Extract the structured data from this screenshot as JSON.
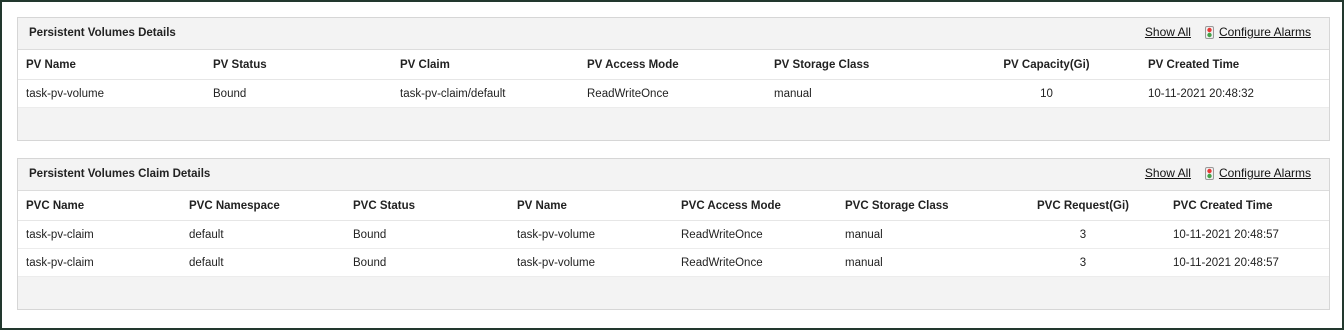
{
  "pv_panel": {
    "title": "Persistent Volumes Details",
    "show_all": "Show All",
    "configure_alarms": "Configure Alarms",
    "columns": [
      "PV Name",
      "PV Status",
      "PV Claim",
      "PV Access Mode",
      "PV Storage Class",
      "PV Capacity(Gi)",
      "PV Created Time"
    ],
    "rows": [
      [
        "task-pv-volume",
        "Bound",
        "task-pv-claim/default",
        "ReadWriteOnce",
        "manual",
        "10",
        "10-11-2021 20:48:32"
      ]
    ]
  },
  "pvc_panel": {
    "title": "Persistent Volumes Claim Details",
    "show_all": "Show All",
    "configure_alarms": "Configure Alarms",
    "columns": [
      "PVC Name",
      "PVC Namespace",
      "PVC Status",
      "PV Name",
      "PVC Access Mode",
      "PVC Storage Class",
      "PVC Request(Gi)",
      "PVC Created Time"
    ],
    "rows": [
      [
        "task-pv-claim",
        "default",
        "Bound",
        "task-pv-volume",
        "ReadWriteOnce",
        "manual",
        "3",
        "10-11-2021 20:48:57"
      ],
      [
        "task-pv-claim",
        "default",
        "Bound",
        "task-pv-volume",
        "ReadWriteOnce",
        "manual",
        "3",
        "10-11-2021 20:48:57"
      ]
    ]
  },
  "colors": {
    "frame_border": "#22382e",
    "panel_bg": "#f3f3f3",
    "alarm_red": "#e53935",
    "alarm_green": "#43a047"
  },
  "icons": {
    "alarm": "traffic-light-icon"
  }
}
